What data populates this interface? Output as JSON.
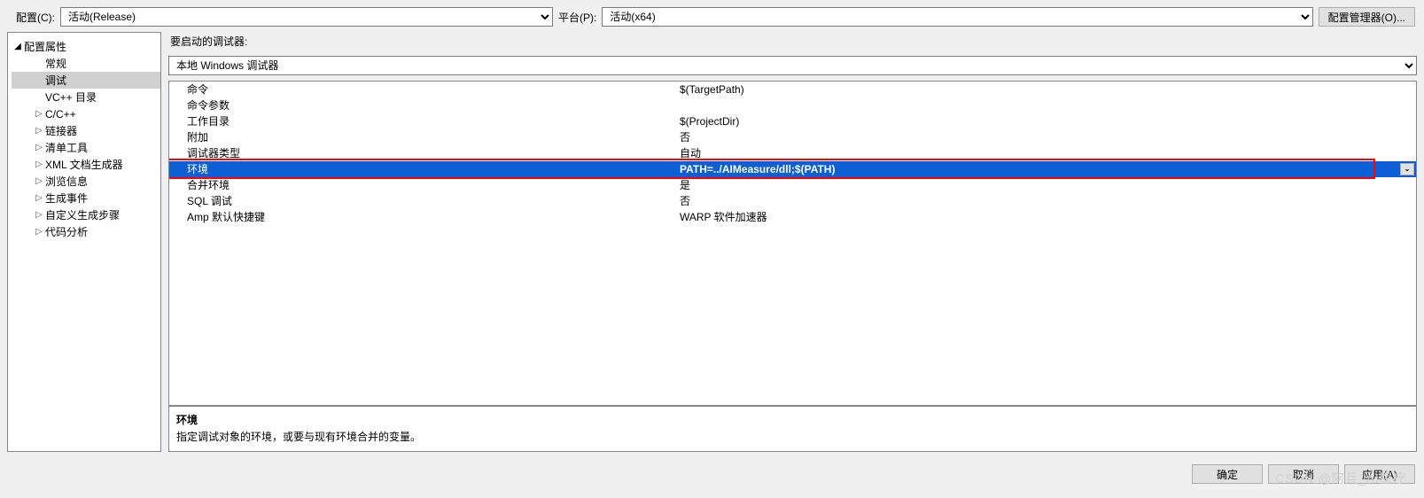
{
  "top": {
    "config_label": "配置(C):",
    "config_value": "活动(Release)",
    "platform_label": "平台(P):",
    "platform_value": "活动(x64)",
    "config_mgr_btn": "配置管理器(O)..."
  },
  "tree": {
    "root_label": "配置属性",
    "items": [
      {
        "label": "常规",
        "expandable": false
      },
      {
        "label": "调试",
        "expandable": false,
        "selected": true
      },
      {
        "label": "VC++ 目录",
        "expandable": false
      },
      {
        "label": "C/C++",
        "expandable": true
      },
      {
        "label": "链接器",
        "expandable": true
      },
      {
        "label": "清单工具",
        "expandable": true
      },
      {
        "label": "XML 文档生成器",
        "expandable": true
      },
      {
        "label": "浏览信息",
        "expandable": true
      },
      {
        "label": "生成事件",
        "expandable": true
      },
      {
        "label": "自定义生成步骤",
        "expandable": true
      },
      {
        "label": "代码分析",
        "expandable": true
      }
    ]
  },
  "section": {
    "start_label": "要启动的调试器:",
    "debugger_value": "本地 Windows 调试器"
  },
  "props": {
    "rows": [
      {
        "name": "命令",
        "value": "$(TargetPath)"
      },
      {
        "name": "命令参数",
        "value": ""
      },
      {
        "name": "工作目录",
        "value": "$(ProjectDir)"
      },
      {
        "name": "附加",
        "value": "否"
      },
      {
        "name": "调试器类型",
        "value": "自动"
      },
      {
        "name": "环境",
        "value": "PATH=../AIMeasure/dll;$(PATH)",
        "selected": true
      },
      {
        "name": "合并环境",
        "value": "是"
      },
      {
        "name": "SQL 调试",
        "value": "否"
      },
      {
        "name": "Amp 默认快捷键",
        "value": "WARP 软件加速器"
      }
    ]
  },
  "desc": {
    "title": "环境",
    "text": "指定调试对象的环境，或要与现有环境合并的变量。"
  },
  "footer": {
    "ok": "确定",
    "cancel": "取消",
    "apply": "应用(A)"
  },
  "watermark": "CSDN @阿兵_AI医疗"
}
